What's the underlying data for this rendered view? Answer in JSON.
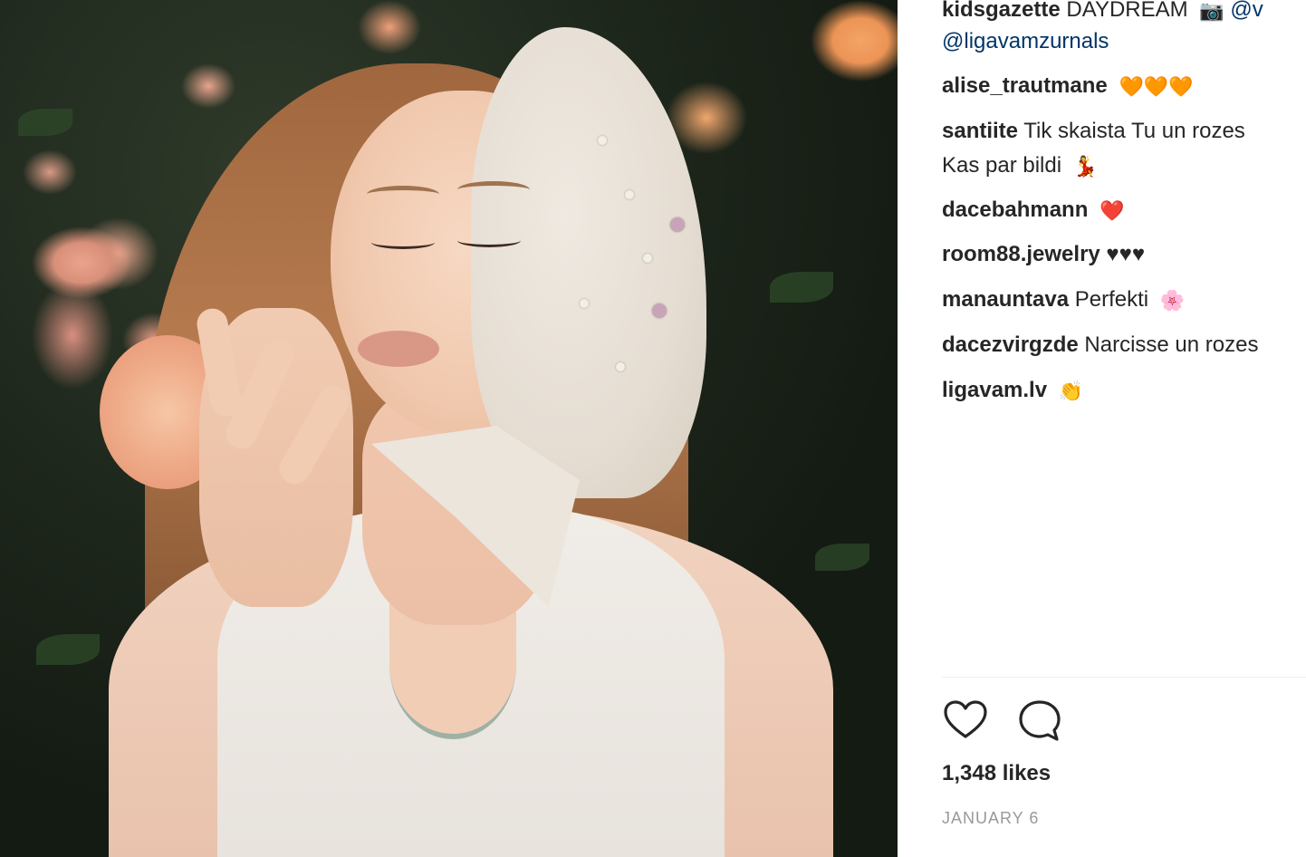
{
  "post": {
    "caption": {
      "user": "kidsgazette",
      "text": "DAYDREAM",
      "emoji": "📷",
      "mention_1": "@v",
      "mention_2": "@ligavamzurnals"
    },
    "comments": [
      {
        "user": "alise_trautmane",
        "text": "",
        "emoji": "🧡🧡🧡"
      },
      {
        "user": "santiite",
        "text": "Tik skaista Tu un rozes ",
        "text2": "Kas par bildi",
        "emoji": "💃"
      },
      {
        "user": "dacebahmann",
        "text": "",
        "emoji": "❤️"
      },
      {
        "user": "room88.jewelry",
        "text": "♥♥♥",
        "emoji": ""
      },
      {
        "user": "manauntava",
        "text": "Perfekti",
        "emoji": "🌸"
      },
      {
        "user": "dacezvirgzde",
        "text": "Narcisse un rozes",
        "emoji": ""
      },
      {
        "user": "ligavam.lv",
        "text": "",
        "emoji": "👏"
      }
    ],
    "likes": "1,348 likes",
    "date": "JANUARY 6"
  },
  "icons": {
    "like": "heart-outline-icon",
    "comment": "speech-bubble-icon"
  },
  "colors": {
    "text": "#262626",
    "link": "#003569",
    "muted": "#999999",
    "divider": "#efefef"
  }
}
